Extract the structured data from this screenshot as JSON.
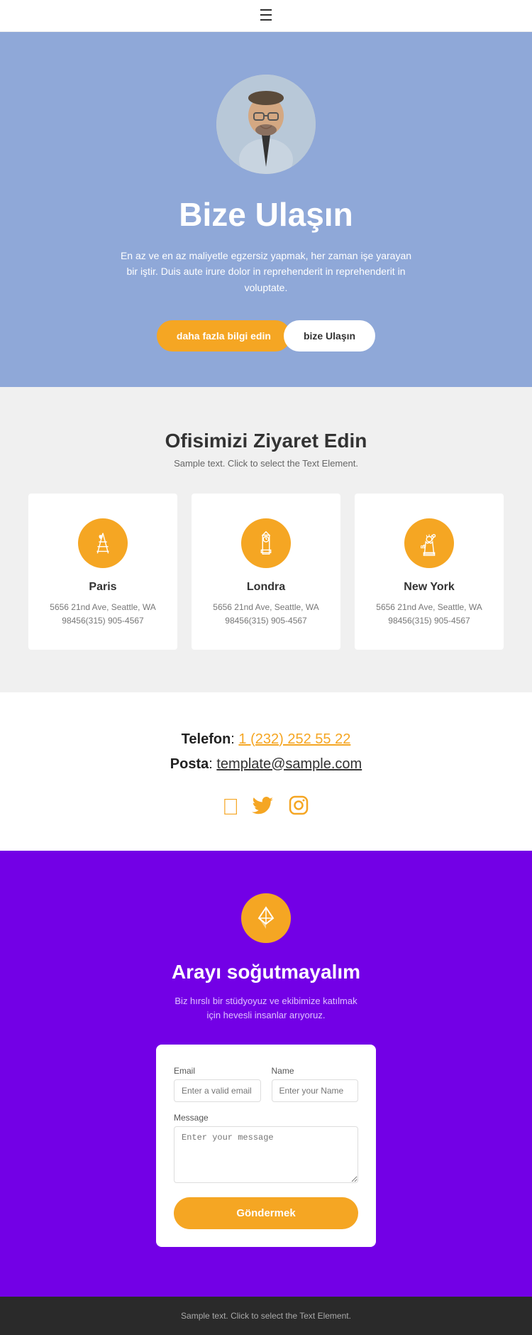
{
  "navbar": {
    "hamburger_label": "☰"
  },
  "hero": {
    "title": "Bize Ulaşın",
    "description": "En az ve en az maliyetle egzersiz yapmak, her zaman işe yarayan bir iştir. Duis aute irure dolor in reprehenderit in reprehenderit in voluptate.",
    "btn_more": "daha fazla bilgi edin",
    "btn_contact": "bize Ulaşın"
  },
  "office": {
    "title": "Ofisimizi Ziyaret Edin",
    "subtitle": "Sample text. Click to select the Text Element.",
    "cards": [
      {
        "city": "Paris",
        "address": "5656 21nd Ave, Seattle, WA\n98456(315) 905-4567",
        "icon": "paris"
      },
      {
        "city": "Londra",
        "address": "5656 21nd Ave, Seattle, WA\n98456(315) 905-4567",
        "icon": "london"
      },
      {
        "city": "New York",
        "address": "5656 21nd Ave, Seattle, WA\n98456(315) 905-4567",
        "icon": "newyork"
      }
    ]
  },
  "contact": {
    "phone_label": "Telefon",
    "phone_number": "1 (232) 252 55 22",
    "email_label": "Posta",
    "email_address": "template@sample.com"
  },
  "cta": {
    "title": "Arayı soğutmayalım",
    "description": "Biz hırslı bir stüdyoyuz ve ekibimize katılmak için hevesli insanlar arıyoruz.",
    "form": {
      "email_label": "Email",
      "email_placeholder": "Enter a valid email add",
      "name_label": "Name",
      "name_placeholder": "Enter your Name",
      "message_label": "Message",
      "message_placeholder": "Enter your message",
      "submit_label": "Göndermek"
    }
  },
  "footer": {
    "text": "Sample text. Click to select the Text Element."
  }
}
